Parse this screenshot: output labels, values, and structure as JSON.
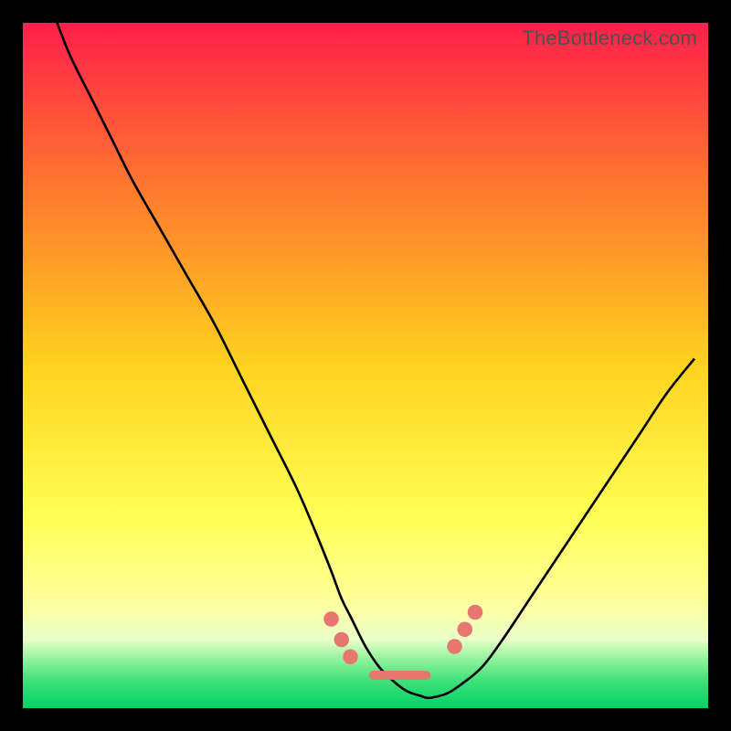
{
  "watermark": "TheBottleneck.com",
  "colors": {
    "top": "#ff1f4a",
    "mid_upper": "#ff7b2e",
    "mid": "#ffd21f",
    "mid_lower": "#ffff55",
    "lower_yellow": "#ffff99",
    "pale": "#eaffc8",
    "green_light": "#8cf29a",
    "green_mid": "#40e07a",
    "green": "#00d463",
    "curve": "#000000",
    "marker": "#e77670"
  },
  "chart_data": {
    "type": "line",
    "title": "",
    "xlabel": "",
    "ylabel": "",
    "xlim": [
      0,
      100
    ],
    "ylim": [
      0,
      100
    ],
    "series": [
      {
        "name": "bottleneck-curve",
        "x_pct": [
          5,
          7,
          10,
          13,
          16,
          20,
          24,
          28,
          32,
          36,
          40,
          43,
          45,
          46.5,
          48,
          50,
          52,
          54,
          56,
          58,
          59,
          60,
          62,
          64,
          67,
          70,
          74,
          78,
          82,
          86,
          90,
          94,
          98
        ],
        "y_pct": [
          100,
          95,
          89,
          83,
          77,
          70,
          63,
          56,
          48,
          40,
          32,
          25,
          20,
          16,
          13,
          9,
          6,
          4,
          2.5,
          1.8,
          1.5,
          1.6,
          2.2,
          3.5,
          6,
          10,
          16,
          22,
          28,
          34,
          40,
          46,
          51
        ]
      }
    ],
    "markers": {
      "name": "highlight-dots",
      "shape": "circle",
      "color": "#e77670",
      "radius_pct": 1.1,
      "points_pct": [
        {
          "x": 45.0,
          "y": 13.0
        },
        {
          "x": 46.5,
          "y": 10.0
        },
        {
          "x": 47.8,
          "y": 7.5
        },
        {
          "x": 63.0,
          "y": 9.0
        },
        {
          "x": 64.5,
          "y": 11.5
        },
        {
          "x": 66.0,
          "y": 14.0
        }
      ]
    },
    "flat_band": {
      "name": "flat-bottom-segment",
      "color": "#e77670",
      "height_pct": 1.3,
      "y_pct": 4.8,
      "x_start_pct": 50.5,
      "x_end_pct": 59.5
    },
    "gradient_stops": [
      {
        "offset": 0.0,
        "color_key": "top"
      },
      {
        "offset": 0.25,
        "color_key": "mid_upper"
      },
      {
        "offset": 0.5,
        "color_key": "mid"
      },
      {
        "offset": 0.72,
        "color_key": "mid_lower"
      },
      {
        "offset": 0.84,
        "color_key": "lower_yellow"
      },
      {
        "offset": 0.9,
        "color_key": "pale"
      },
      {
        "offset": 0.93,
        "color_key": "green_light"
      },
      {
        "offset": 0.96,
        "color_key": "green_mid"
      },
      {
        "offset": 1.0,
        "color_key": "green"
      }
    ]
  }
}
